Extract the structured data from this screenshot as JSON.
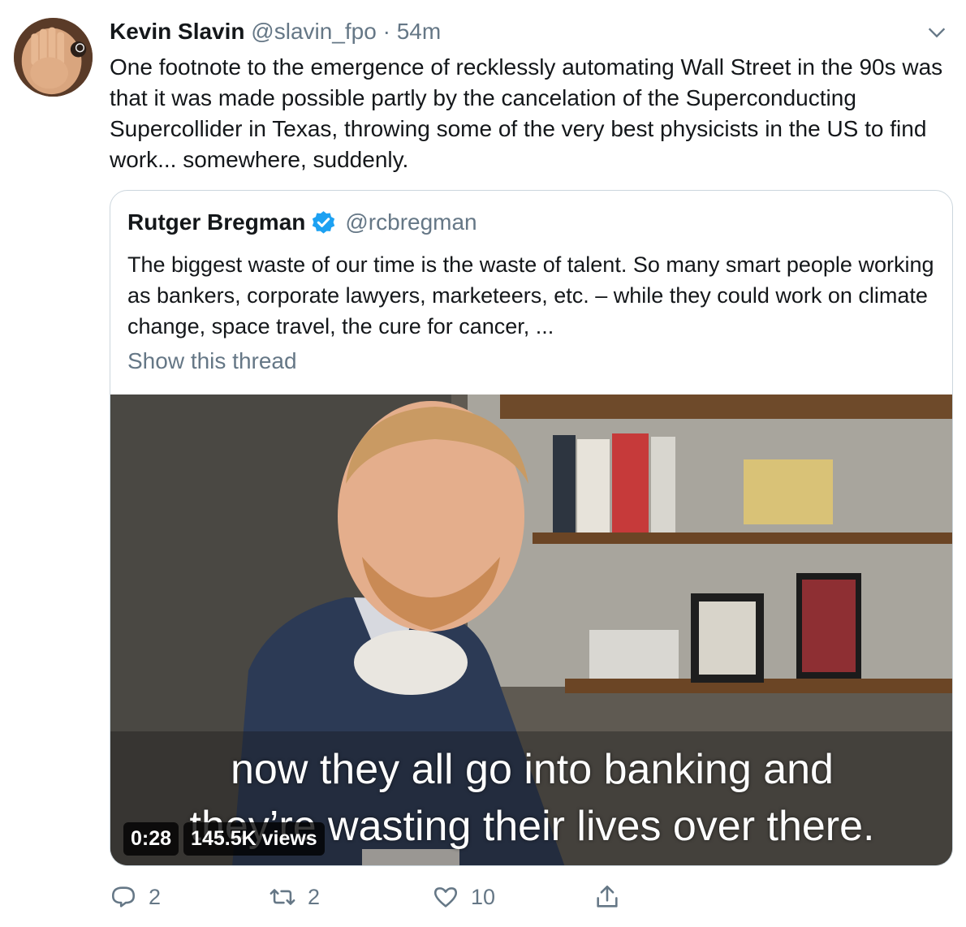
{
  "author": {
    "name": "Kevin Slavin",
    "handle": "@slavin_fpo",
    "separator": "·",
    "time": "54m",
    "avatar_icon": "user-avatar"
  },
  "tweet_text": "One footnote to the emergence of recklessly automating Wall Street in the 90s was that it was made possible partly by the cancelation of the Superconducting Supercollider in Texas, throwing some of the very best physicists in the US to find work... somewhere, suddenly.",
  "quoted": {
    "name": "Rutger Bregman",
    "verified": true,
    "handle": "@rcbregman",
    "text": "The biggest waste of our time is the waste of talent. So many smart people working as bankers, corporate lawyers, marketeers, etc. – while they could work on climate change, space travel, the cure for cancer, ...",
    "show_thread_label": "Show this thread",
    "video": {
      "caption_line1": "now they all go into banking and",
      "caption_line2": "they’re wasting their lives over there.",
      "duration": "0:28",
      "views": "145.5K views"
    }
  },
  "actions": {
    "reply_count": "2",
    "retweet_count": "2",
    "like_count": "10"
  },
  "colors": {
    "text": "#14171a",
    "secondary": "#657786",
    "border": "#ccd6dd",
    "verified": "#1da1f2"
  }
}
